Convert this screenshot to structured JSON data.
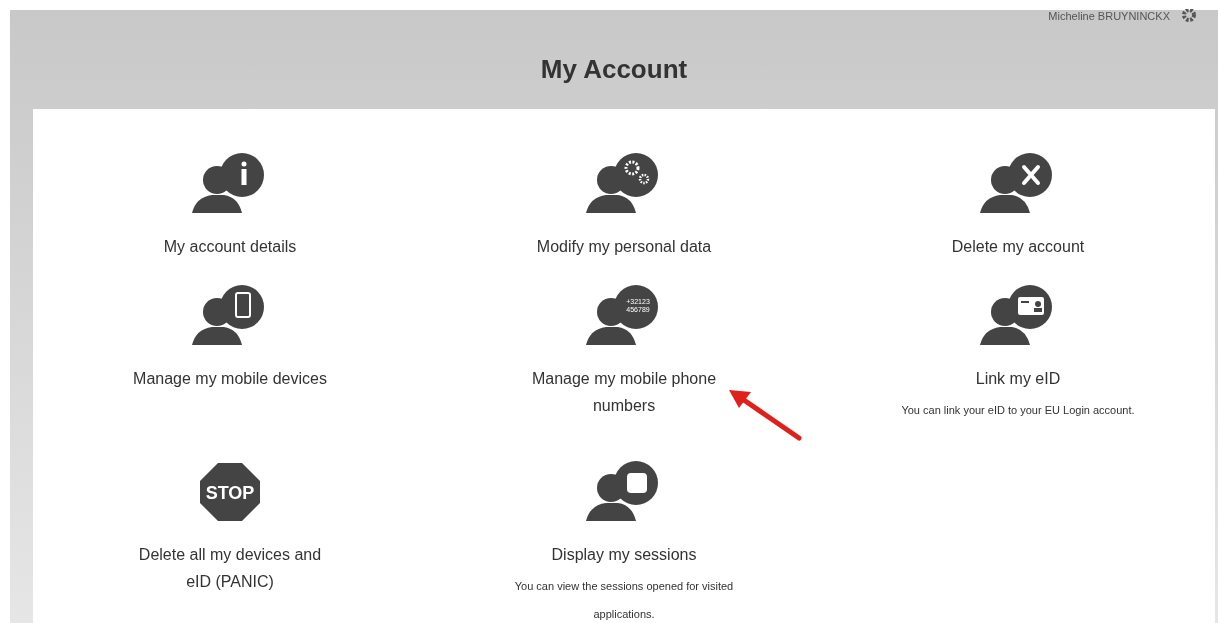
{
  "header": {
    "user_name": "Micheline BRUYNINCKX",
    "title": "My Account"
  },
  "items": [
    {
      "kind": "info",
      "label": "My account details"
    },
    {
      "kind": "gears",
      "label": "Modify my personal data"
    },
    {
      "kind": "delete",
      "label": "Delete my account"
    },
    {
      "kind": "device",
      "label": "Manage my mobile devices"
    },
    {
      "kind": "numbers",
      "label": "Manage my mobile phone numbers",
      "icon_text": [
        "+32123",
        "456789"
      ]
    },
    {
      "kind": "card",
      "label": "Link my eID",
      "note": "You can link your eID to your EU Login account."
    },
    {
      "kind": "stop",
      "label": "Delete all my devices and eID (PANIC)",
      "icon_text": [
        "STOP"
      ]
    },
    {
      "kind": "session",
      "label": "Display my sessions",
      "note": "You can view the sessions opened for visited applications."
    }
  ]
}
